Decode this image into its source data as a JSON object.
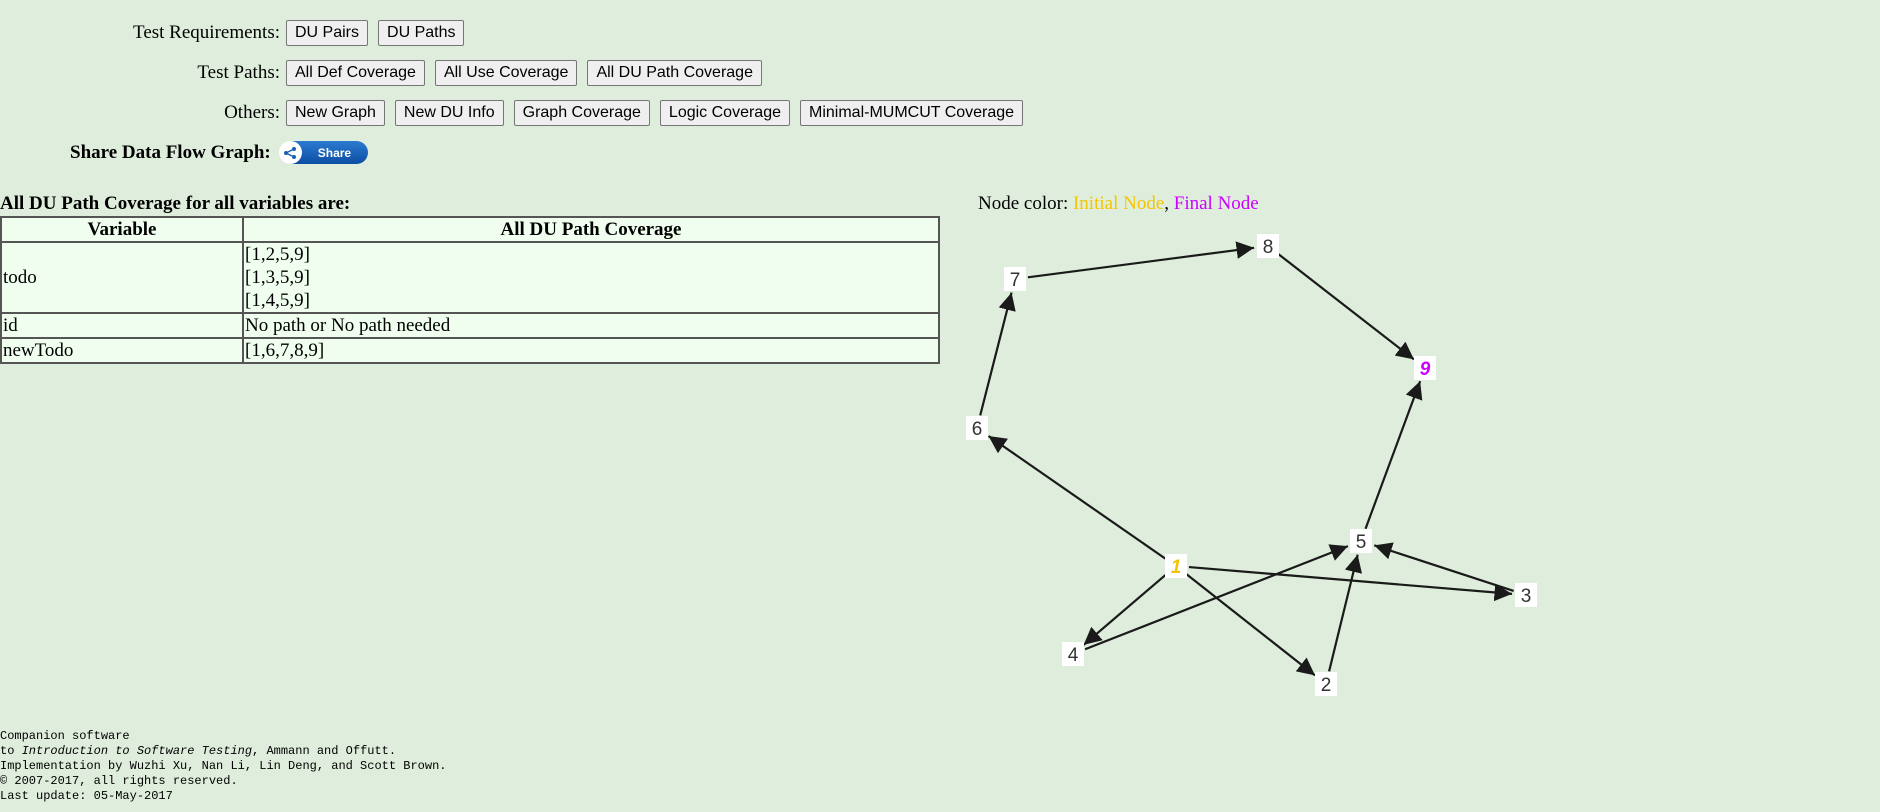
{
  "toolbar": {
    "test_requirements": {
      "label": "Test Requirements:",
      "buttons": [
        "DU Pairs",
        "DU Paths"
      ]
    },
    "test_paths": {
      "label": "Test Paths:",
      "buttons": [
        "All Def Coverage",
        "All Use Coverage",
        "All DU Path Coverage"
      ]
    },
    "others": {
      "label": "Others:",
      "buttons": [
        "New Graph",
        "New DU Info",
        "Graph Coverage",
        "Logic Coverage",
        "Minimal-MUMCUT Coverage"
      ]
    },
    "share": {
      "label": "Share Data Flow Graph:",
      "button_label": "Share",
      "icon": "share-icon"
    }
  },
  "coverage": {
    "title": "All DU Path Coverage for all variables are:",
    "headers": [
      "Variable",
      "All DU Path Coverage"
    ],
    "rows": [
      {
        "variable": "todo",
        "paths": [
          "[1,2,5,9]",
          "[1,3,5,9]",
          "[1,4,5,9]"
        ]
      },
      {
        "variable": "id",
        "paths": [
          "No path or No path needed"
        ]
      },
      {
        "variable": "newTodo",
        "paths": [
          "[1,6,7,8,9]"
        ]
      }
    ]
  },
  "legend": {
    "prefix": "Node color: ",
    "initial": "Initial Node",
    "separator": ", ",
    "final": "Final Node",
    "initial_color": "#f5c400",
    "final_color": "#cc00ff"
  },
  "graph": {
    "nodes": [
      "1",
      "2",
      "3",
      "4",
      "5",
      "6",
      "7",
      "8",
      "9"
    ],
    "initial_node": "1",
    "final_node": "9",
    "edges": [
      [
        "1",
        "2"
      ],
      [
        "1",
        "3"
      ],
      [
        "1",
        "4"
      ],
      [
        "1",
        "6"
      ],
      [
        "2",
        "5"
      ],
      [
        "3",
        "5"
      ],
      [
        "4",
        "5"
      ],
      [
        "5",
        "9"
      ],
      [
        "6",
        "7"
      ],
      [
        "7",
        "8"
      ],
      [
        "8",
        "9"
      ]
    ]
  },
  "footer": {
    "line1": "Companion software",
    "line2_prefix": "to ",
    "line2_book": "Introduction to Software Testing",
    "line2_suffix": ", Ammann and Offutt.",
    "line3": "Implementation by Wuzhi Xu, Nan Li, Lin Deng, and Scott Brown.",
    "line4": "© 2007-2017, all rights reserved.",
    "line5": "Last update: 05-May-2017"
  }
}
